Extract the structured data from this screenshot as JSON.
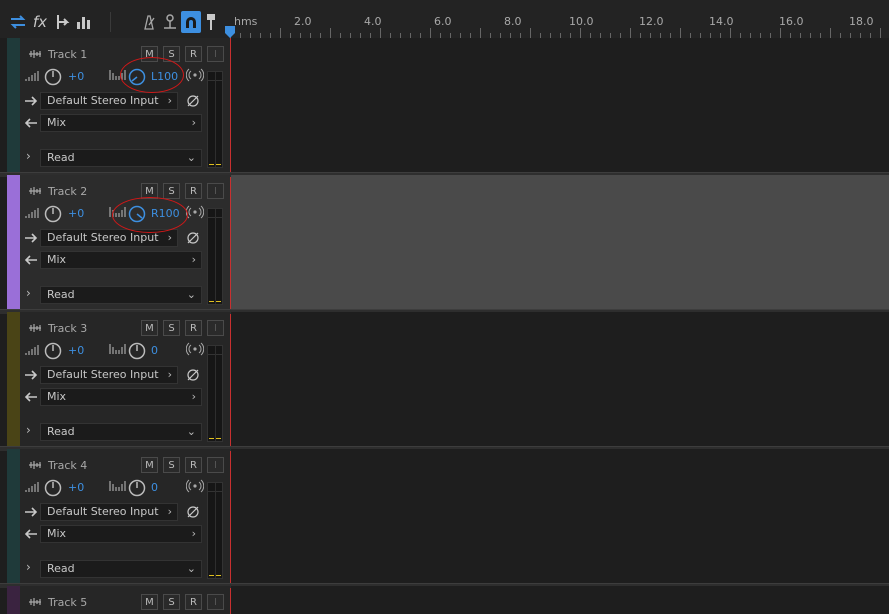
{
  "toolbar": {
    "icons": [
      "swap-arrows-icon",
      "fx-icon",
      "routing-icon",
      "levels-icon",
      "metronome-icon",
      "snap-icon",
      "magnet-icon",
      "marker-pin-icon"
    ],
    "fx_label": "fx"
  },
  "ruler": {
    "unit_label": "hms",
    "ticks": [
      "2.0",
      "4.0",
      "6.0",
      "8.0",
      "10.0",
      "12.0",
      "14.0",
      "16.0",
      "18.0"
    ]
  },
  "colors": {
    "accent": "#3d8fe0",
    "playhead": "#c83030",
    "annotation": "#d01818"
  },
  "tracks": [
    {
      "name": "Track 1",
      "color": "#1f3a3a",
      "volume": "+0",
      "pan": "L100",
      "input": "Default Stereo Input",
      "output": "Mix",
      "automation": "Read",
      "m": "M",
      "s": "S",
      "r": "R",
      "i": "I",
      "selected": false
    },
    {
      "name": "Track 2",
      "color": "#9a6fd8",
      "volume": "+0",
      "pan": "R100",
      "input": "Default Stereo Input",
      "output": "Mix",
      "automation": "Read",
      "m": "M",
      "s": "S",
      "r": "R",
      "i": "I",
      "selected": true
    },
    {
      "name": "Track 3",
      "color": "#4a4416",
      "volume": "+0",
      "pan": "0",
      "input": "Default Stereo Input",
      "output": "Mix",
      "automation": "Read",
      "m": "M",
      "s": "S",
      "r": "R",
      "i": "I",
      "selected": false
    },
    {
      "name": "Track 4",
      "color": "#1f3a3a",
      "volume": "+0",
      "pan": "0",
      "input": "Default Stereo Input",
      "output": "Mix",
      "automation": "Read",
      "m": "M",
      "s": "S",
      "r": "R",
      "i": "I",
      "selected": false
    },
    {
      "name": "Track 5",
      "color": "#3a2340",
      "m": "M",
      "s": "S",
      "r": "R",
      "i": "I"
    }
  ]
}
